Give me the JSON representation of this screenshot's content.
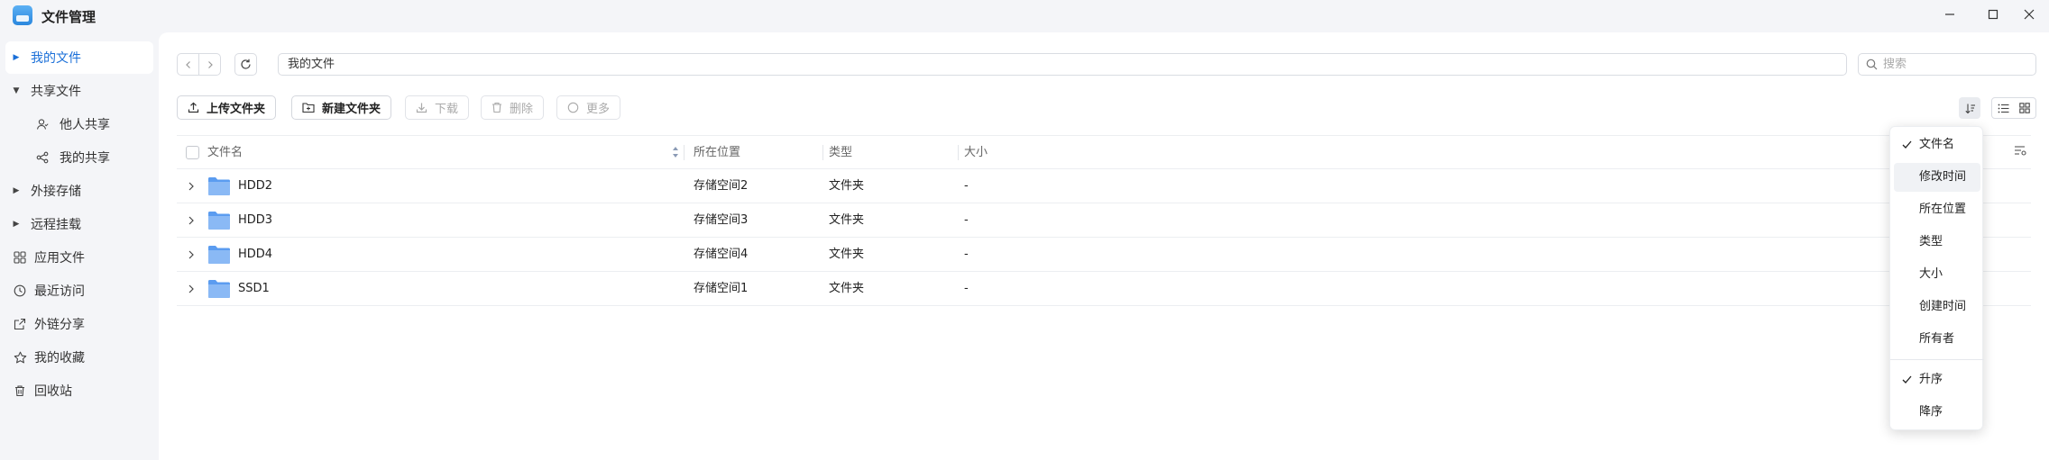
{
  "app": {
    "title": "文件管理"
  },
  "window_controls": [
    "minimize-icon",
    "maximize-icon",
    "close-icon"
  ],
  "sidebar": {
    "items": [
      {
        "id": "my-files",
        "label": "我的文件",
        "caret": "right",
        "active": true
      },
      {
        "id": "shared-files",
        "label": "共享文件",
        "caret": "down"
      },
      {
        "id": "shared-by-others",
        "label": "他人共享",
        "icon": "person-icon"
      },
      {
        "id": "my-shares",
        "label": "我的共享",
        "icon": "share-icon"
      },
      {
        "id": "external-storage",
        "label": "外接存储",
        "caret": "right"
      },
      {
        "id": "remote-mount",
        "label": "远程挂载",
        "caret": "right"
      },
      {
        "id": "app-files",
        "label": "应用文件",
        "icon": "grid-icon"
      },
      {
        "id": "recent",
        "label": "最近访问",
        "icon": "clock-icon"
      },
      {
        "id": "external-links",
        "label": "外链分享",
        "icon": "link-share-icon"
      },
      {
        "id": "favorites",
        "label": "我的收藏",
        "icon": "star-icon"
      },
      {
        "id": "recycle-bin",
        "label": "回收站",
        "icon": "trash-icon"
      }
    ]
  },
  "path_bar": {
    "value": "我的文件"
  },
  "search": {
    "placeholder": "搜索"
  },
  "toolbar": {
    "upload": "上传文件夹",
    "new_folder": "新建文件夹",
    "download": "下载",
    "delete": "删除",
    "more": "更多"
  },
  "table": {
    "columns": {
      "name": "文件名",
      "location": "所在位置",
      "type": "类型",
      "size": "大小"
    },
    "rows": [
      {
        "name": "HDD2",
        "location": "存储空间2",
        "type": "文件夹",
        "size": "-"
      },
      {
        "name": "HDD3",
        "location": "存储空间3",
        "type": "文件夹",
        "size": "-"
      },
      {
        "name": "HDD4",
        "location": "存储空间4",
        "type": "文件夹",
        "size": "-"
      },
      {
        "name": "SSD1",
        "location": "存储空间1",
        "type": "文件夹",
        "size": "-"
      }
    ]
  },
  "sort_menu": {
    "fields": [
      {
        "label": "文件名",
        "checked": true
      },
      {
        "label": "修改时间",
        "hover": true
      },
      {
        "label": "所在位置"
      },
      {
        "label": "类型"
      },
      {
        "label": "大小"
      },
      {
        "label": "创建时间"
      },
      {
        "label": "所有者"
      }
    ],
    "orders": [
      {
        "label": "升序",
        "checked": true
      },
      {
        "label": "降序"
      }
    ]
  },
  "colors": {
    "accent": "#1a6fd8",
    "folder": "#5b9cf0",
    "sidebar_bg": "#f4f5f8"
  }
}
